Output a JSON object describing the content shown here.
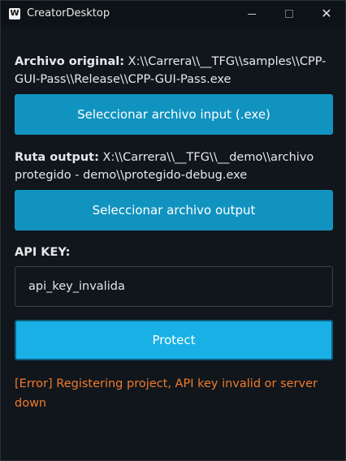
{
  "window": {
    "icon_letter": "W",
    "title": "CreatorDesktop",
    "minimize_glyph": "minimize",
    "maximize_glyph": "maximize",
    "close_glyph": "✕"
  },
  "input_file": {
    "label": "Archivo original:",
    "path": "X:\\\\Carrera\\\\__TFG\\\\samples\\\\CPP-GUI-Pass\\\\Release\\\\CPP-GUI-Pass.exe",
    "button_label": "Seleccionar archivo input (.exe)"
  },
  "output_file": {
    "label": "Ruta output:",
    "path": "X:\\\\Carrera\\\\__TFG\\\\__demo\\\\archivo protegido - demo\\\\protegido-debug.exe",
    "button_label": "Seleccionar archivo output"
  },
  "api_key": {
    "label": "API KEY:",
    "value": "api_key_invalida"
  },
  "protect": {
    "button_label": "Protect"
  },
  "status": {
    "error_text": "[Error] Registering project, API key invalid or server down",
    "error_color": "#f27a2a"
  },
  "colors": {
    "background": "#10161c",
    "button": "#1193c0",
    "protect_button": "#19b0e6"
  }
}
